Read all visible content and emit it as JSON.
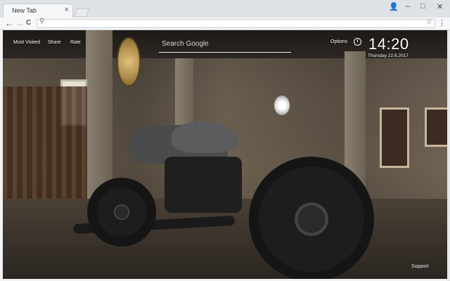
{
  "browser": {
    "tab_title": "New Tab",
    "tab_close": "×",
    "window_controls": {
      "user": "👤",
      "minimize": "–",
      "maximize": "□",
      "close": "✕"
    },
    "nav": {
      "back": "←",
      "forward": "→",
      "reload": "C"
    },
    "omnibox_icon": "search-icon",
    "star_icon": "☆",
    "menu_icon": "⋮"
  },
  "newtab": {
    "top_links": [
      "Most Visited",
      "Share",
      "Rate"
    ],
    "search_placeholder": "Search Google",
    "options_label": "Options",
    "time": "14:20",
    "date": "Thursday  22.6.2017",
    "support_label": "Support"
  },
  "colors": {
    "chrome_bg": "#dee1e6",
    "tab_bg": "#f6f7f8",
    "text_white": "#ffffff"
  }
}
